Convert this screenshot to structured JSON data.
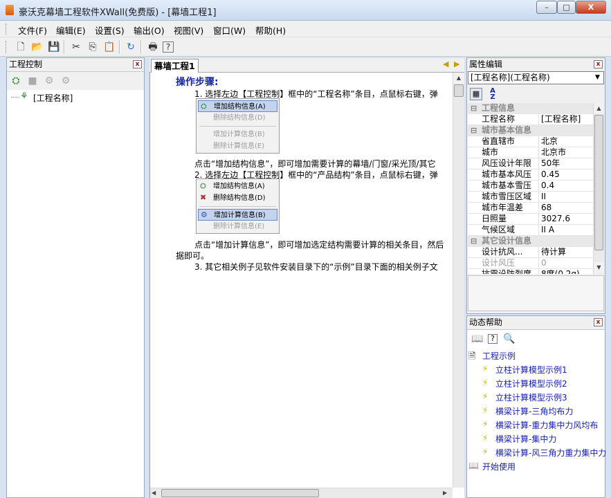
{
  "window": {
    "title": "豪沃克幕墙工程软件XWall(免费版) - [幕墙工程1]",
    "minimize": "–",
    "restore": "□",
    "close": "X"
  },
  "menu": [
    "文件(F)",
    "编辑(E)",
    "设置(S)",
    "输出(O)",
    "视图(V)",
    "窗口(W)",
    "帮助(H)"
  ],
  "toolbar_icons": [
    "new-icon",
    "open-icon",
    "save-icon",
    "cut-icon",
    "copy-icon",
    "paste-icon",
    "refresh-icon",
    "print-icon",
    "help-icon"
  ],
  "left_panel": {
    "title": "工程控制",
    "tree_root": "[工程名称]"
  },
  "doc": {
    "tab": "幕墙工程1",
    "heading": "操作步骤:",
    "step1": "1.   选择左边【工程控制】框中的“工程名称”条目，点鼠标右键，弹",
    "menu1": [
      "增加结构信息(A)",
      "删除结构信息(D)",
      "增加计算信息(B)",
      "删除计算信息(E)"
    ],
    "para1": "点击“增加结构信息”，即可增加需要计算的幕墙/门窗/采光顶/其它",
    "step2": "2.   选择左边【工程控制】框中的“产品结构”条目，点鼠标右键，弹",
    "menu2": [
      "增加结构信息(A)",
      "删除结构信息(D)",
      "增加计算信息(B)",
      "删除计算信息(E)"
    ],
    "para2a": "点击“增加计算信息”，即可增加选定结构需要计算的相关条目，然后",
    "para2b": "据即可。",
    "step3": "3.    其它相关例子见软件安装目录下的“示例”目录下面的相关例子文"
  },
  "properties": {
    "title": "属性编辑",
    "selector": "[工程名称](工程名称)",
    "rows": [
      {
        "type": "cat",
        "key": "工程信息"
      },
      {
        "key": "工程名称",
        "value": "[工程名称]"
      },
      {
        "type": "cat",
        "key": "城市基本信息"
      },
      {
        "key": "省直辖市",
        "value": "北京"
      },
      {
        "key": "城市",
        "value": "北京市"
      },
      {
        "key": "风压设计年限",
        "value": "50年"
      },
      {
        "key": "城市基本风压",
        "value": "0.45"
      },
      {
        "key": "城市基本雪压",
        "value": "0.4"
      },
      {
        "key": "城市雪压区域",
        "value": "II"
      },
      {
        "key": "城市年温差",
        "value": "68"
      },
      {
        "key": "日照量",
        "value": "3027.6"
      },
      {
        "key": "气候区域",
        "value": "II A"
      },
      {
        "type": "cat",
        "key": "其它设计信息"
      },
      {
        "key": "设计抗风...",
        "value": "待计算"
      },
      {
        "key": "设计风压",
        "value": "0",
        "dim": true
      },
      {
        "key": "抗震设防烈度",
        "value": "8度(0.2g)"
      }
    ]
  },
  "help": {
    "title": "动态帮助",
    "section": "工程示例",
    "items": [
      "立柱计算模型示例1",
      "立柱计算模型示例2",
      "立柱计算模型示例3",
      "横梁计算-三角均布力",
      "横梁计算-重力集中力风均布",
      "横梁计算-集中力",
      "横梁计算-风三角力重力集中力"
    ],
    "footer": "开始使用"
  },
  "colors": {
    "accent_blue": "#1a2a9c",
    "link_blue": "#1722a8",
    "highlight": "#c5d4ee"
  }
}
